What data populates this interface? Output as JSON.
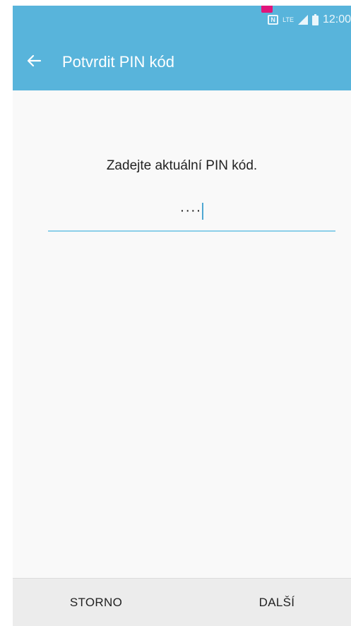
{
  "status_bar": {
    "nfc": "N",
    "network": "LTE",
    "time": "12:00"
  },
  "app_bar": {
    "back_icon": "arrow-left-icon",
    "title": "Potvrdit PIN kód"
  },
  "content": {
    "prompt": "Zadejte aktuální PIN kód.",
    "pin_field": {
      "value": "····",
      "masked": true
    }
  },
  "bottom_bar": {
    "cancel_label": "STORNO",
    "next_label": "DALŠÍ"
  },
  "colors": {
    "accent": "#58b4db",
    "underline": "#8ccfe9",
    "notification": "#e0157a"
  }
}
